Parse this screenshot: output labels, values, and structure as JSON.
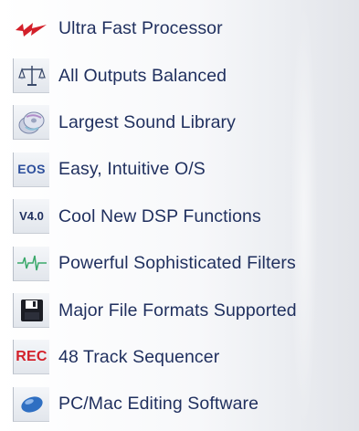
{
  "features": [
    {
      "label": "Ultra Fast Processor",
      "icon": "lightning-bolt-icon"
    },
    {
      "label": "All Outputs Balanced",
      "icon": "balance-scale-icon"
    },
    {
      "label": "Largest Sound Library",
      "icon": "disc-stack-icon",
      "icon_text": ""
    },
    {
      "label": "Easy, Intuitive O/S",
      "icon": "eos-text-icon",
      "icon_text": "EOS"
    },
    {
      "label": "Cool New DSP Functions",
      "icon": "version-text-icon",
      "icon_text": "V4.0"
    },
    {
      "label": "Powerful Sophisticated Filters",
      "icon": "waveform-icon"
    },
    {
      "label": "Major File Formats Supported",
      "icon": "floppy-disk-icon"
    },
    {
      "label": "48 Track Sequencer",
      "icon": "rec-text-icon",
      "icon_text": "REC"
    },
    {
      "label": "PC/Mac Editing Software",
      "icon": "mouse-icon"
    }
  ],
  "colors": {
    "label": "#1f2f5e",
    "bolt_red": "#d3202a",
    "eos_blue": "#2d4f9c",
    "rec_red": "#d3202a"
  }
}
